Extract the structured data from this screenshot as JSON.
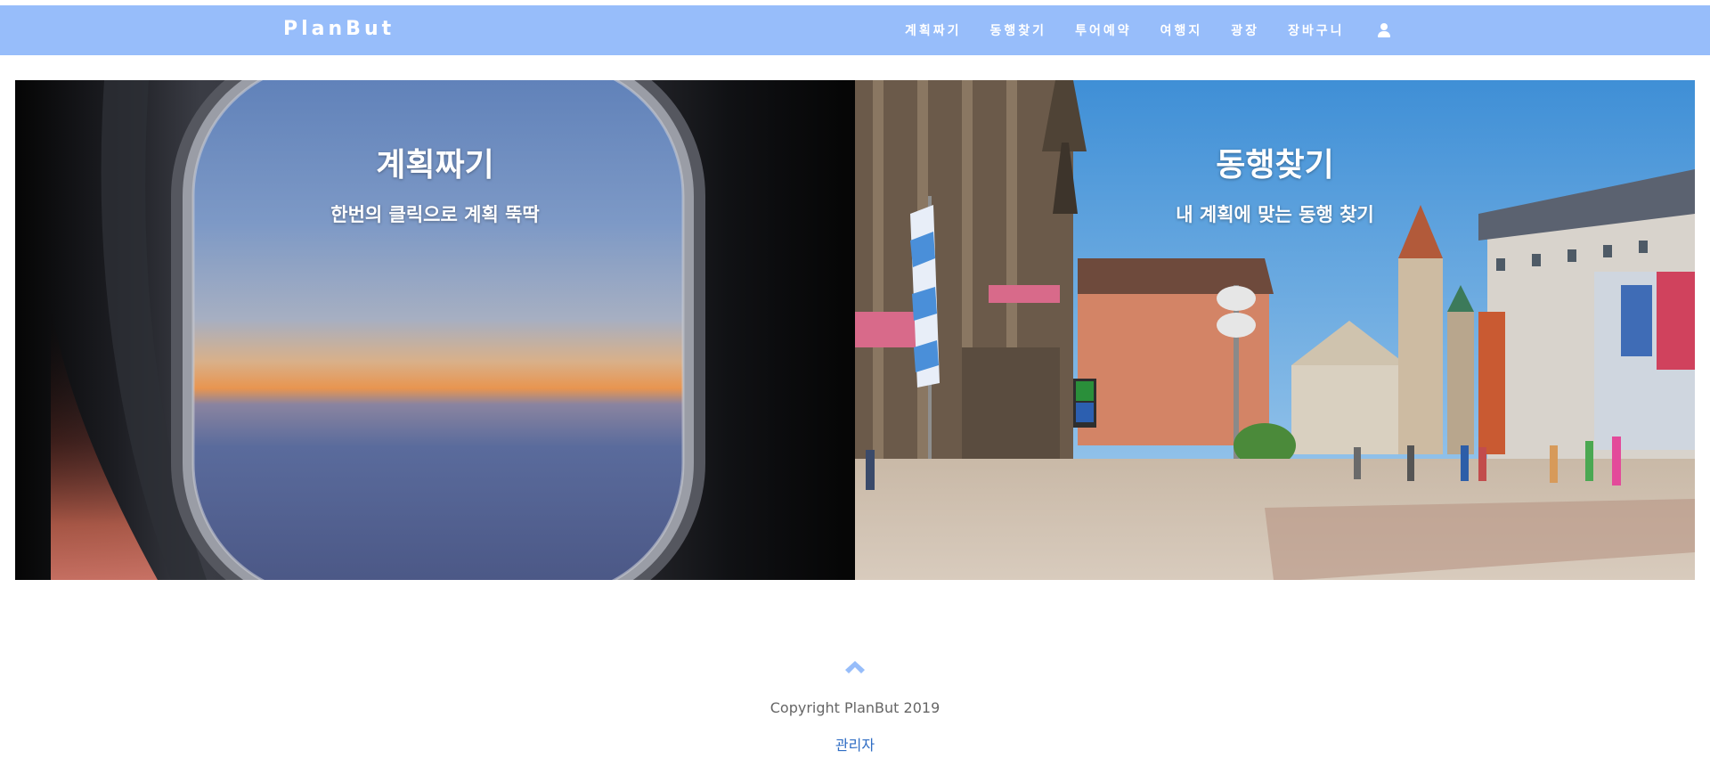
{
  "navbar": {
    "brand": "PlanBut",
    "links": [
      "계획짜기",
      "동행찾기",
      "투어예약",
      "여행지",
      "광장",
      "장바구니"
    ],
    "user_icon": "user-icon",
    "background": "#97bdfa"
  },
  "panels": [
    {
      "title": "계획짜기",
      "subtitle": "한번의 클릭으로 계획 뚝딱",
      "image": "airplane-window-photo"
    },
    {
      "title": "동행찾기",
      "subtitle": "내 계획에 맞는 동행 찾기",
      "image": "city-square-photo"
    }
  ],
  "footer": {
    "scroll_top_icon": "chevron-up-icon",
    "copyright": "Copyright PlanBut 2019",
    "admin": "관리자",
    "accent": "#97bdfa",
    "link_color": "#2f6dc4"
  }
}
